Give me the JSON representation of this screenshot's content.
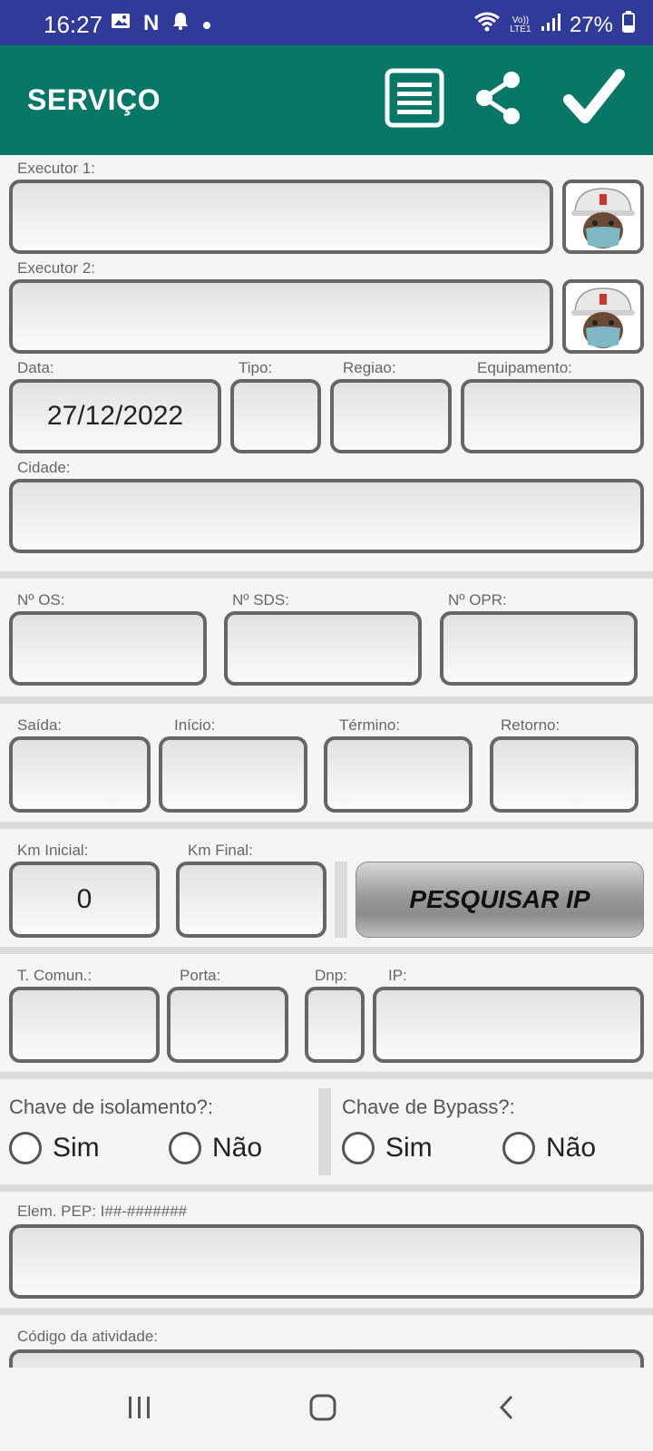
{
  "status_bar": {
    "time": "16:27",
    "battery": "27%",
    "volte": "Vo)) LTE1"
  },
  "app_bar": {
    "title": "SERVIÇO",
    "actions": [
      "list-icon",
      "share-icon",
      "check-icon"
    ]
  },
  "form": {
    "executor1_label": "Executor 1:",
    "executor2_label": "Executor 2:",
    "date_label": "Data:",
    "date_value": "27/12/2022",
    "tipo_label": "Tipo:",
    "regiao_label": "Regiao:",
    "equipamento_label": "Equipamento:",
    "cidade_label": "Cidade:",
    "os_label": "Nº OS:",
    "sds_label": "Nº SDS:",
    "opr_label": "Nº OPR:",
    "saida_label": "Saída:",
    "inicio_label": "Início:",
    "termino_label": "Término:",
    "retorno_label": "Retorno:",
    "km_inicial_label": "Km Inicial:",
    "km_inicial_value": "0",
    "km_final_label": "Km Final:",
    "pesquisar_ip_label": "PESQUISAR IP",
    "tcomun_label": "T. Comun.:",
    "porta_label": "Porta:",
    "dnp_label": "Dnp:",
    "ip_label": "IP:",
    "chave_isolamento_label": "Chave de isolamento?:",
    "chave_bypass_label": "Chave de Bypass?:",
    "sim_label": "Sim",
    "nao_label": "Não",
    "pep_label": "Elem. PEP: I##-#######",
    "codigo_label": "Código da atividade:"
  },
  "colors": {
    "status_bar": "#2f3a99",
    "app_bar": "#077868",
    "field_border": "#666666"
  }
}
